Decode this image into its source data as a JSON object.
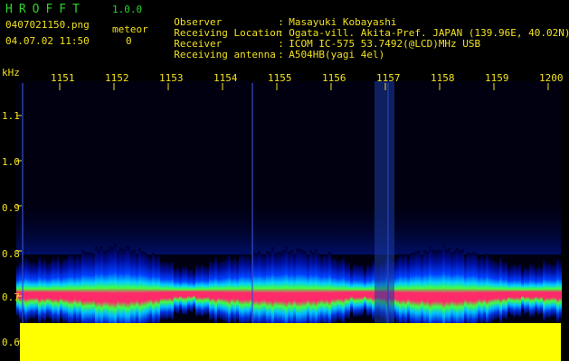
{
  "header": {
    "app_title": "HROFFT",
    "version": "1.0.0",
    "filename": "0407021150.png",
    "meteor_label": "meteor",
    "meteor_count": "0",
    "datetime": "04.07.02 11:50"
  },
  "info": [
    {
      "label": "Observer",
      "value": "Masayuki Kobayashi"
    },
    {
      "label": "Receiving Location",
      "value": "Ogata-vill. Akita-Pref. JAPAN (139.96E, 40.02N)"
    },
    {
      "label": "Receiver",
      "value": "ICOM IC-575 53.7492(@LCD)MHz USB"
    },
    {
      "label": "Receiving antenna",
      "value": "A504HB(yagi 4el)"
    }
  ],
  "axis": {
    "y_unit": "kHz",
    "time_ticks": [
      "1151",
      "1152",
      "1153",
      "1154",
      "1155",
      "1156",
      "1157",
      "1158",
      "1159",
      "1200"
    ],
    "freq_ticks": [
      "1.1",
      "1.0",
      "0.9",
      "0.8",
      "0.7",
      "0.6"
    ]
  },
  "colors": {
    "title_green": "#2bd52b",
    "text_yellow": "#f0e020",
    "band_core": "#ff2a6a",
    "baseline": "#ffff00"
  }
}
